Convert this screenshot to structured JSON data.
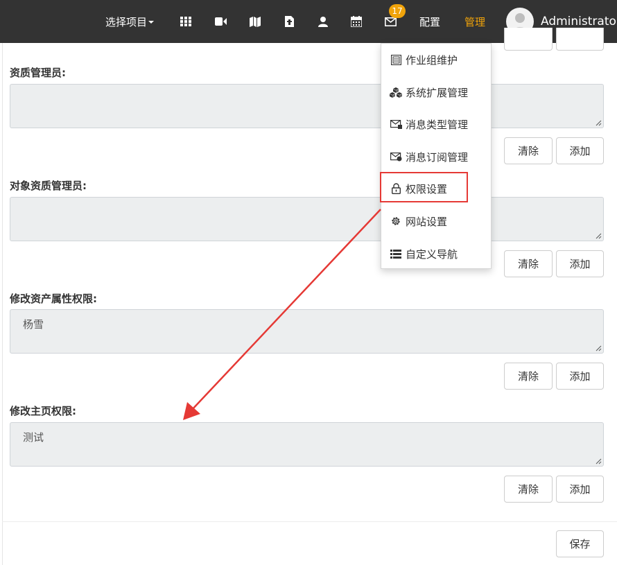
{
  "navbar": {
    "project_select": "选择项目",
    "icons": [
      "grid-icon",
      "video-icon",
      "map-icon",
      "document-icon",
      "user-icon",
      "calendar-icon",
      "mail-icon"
    ],
    "mail_badge": "17",
    "config_label": "配置",
    "manage_label": "管理",
    "user_name": "Administrator",
    "accent_color": "#f0a30a"
  },
  "fields": [
    {
      "label": "资质管理员:",
      "value": ""
    },
    {
      "label": "对象资质管理员:",
      "value": ""
    },
    {
      "label": "修改资产属性权限:",
      "value": "杨雪"
    },
    {
      "label": "修改主页权限:",
      "value": "测试"
    }
  ],
  "buttons": {
    "clear": "清除",
    "add": "添加",
    "save": "保存"
  },
  "dropdown": {
    "items": [
      {
        "label": "作业组维护",
        "icon": "workgroup-icon"
      },
      {
        "label": "系统扩展管理",
        "icon": "cubes-icon"
      },
      {
        "label": "消息类型管理",
        "icon": "message-type-icon"
      },
      {
        "label": "消息订阅管理",
        "icon": "message-subscribe-icon"
      },
      {
        "label": "权限设置",
        "icon": "lock-icon"
      },
      {
        "label": "网站设置",
        "icon": "gear-icon"
      },
      {
        "label": "自定义导航",
        "icon": "list-icon"
      }
    ]
  },
  "annotation": {
    "highlight_color": "#e53935"
  }
}
